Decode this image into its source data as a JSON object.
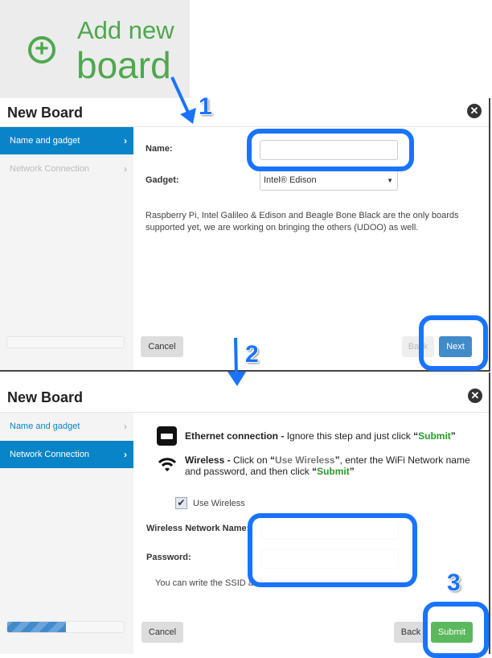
{
  "add_board": {
    "line1": "Add new",
    "line2": "board",
    "icon": "plus-circle-icon",
    "color": "#4ea84e"
  },
  "annotations": {
    "step1": "1",
    "step2": "2",
    "step3": "3",
    "color": "#1a73ff"
  },
  "panel1": {
    "title": "New Board",
    "sidebar": [
      {
        "label": "Name and gadget",
        "active": true
      },
      {
        "label": "Network Connection",
        "active": false
      }
    ],
    "name_label": "Name:",
    "name_value": "",
    "gadget_label": "Gadget:",
    "gadget_value": "Intel® Edison",
    "info": "Raspberry Pi, Intel Galileo & Edison and Beagle Bone Black are the only boards supported yet, we are working on bringing the others (UDOO) as well.",
    "progress_percent": 0,
    "cancel": "Cancel",
    "back": "Back",
    "next": "Next"
  },
  "panel2": {
    "title": "New Board",
    "sidebar": [
      {
        "label": "Name and gadget",
        "active": false
      },
      {
        "label": "Network Connection",
        "active": true
      }
    ],
    "ethernet": {
      "title": "Ethernet connection",
      "dash": " - ",
      "text": "Ignore this step and just click ",
      "q1": "“",
      "submit": "Submit",
      "q2": "”"
    },
    "wireless": {
      "title": "Wireless",
      "dash": " - ",
      "t1": "Click on ",
      "q1": "“",
      "use": "Use Wireless",
      "q2": "”",
      "t2": ", enter the WiFi Network name and password, and then click ",
      "q3": "“",
      "submit": "Submit",
      "q4": "”"
    },
    "use_wireless": "Use Wireless",
    "use_wireless_checked": true,
    "ssid_label": "Wireless Network Name:",
    "ssid_value": "",
    "password_label": "Password:",
    "password_value": "",
    "note": "You can write the SSID and",
    "progress_percent": 50,
    "cancel": "Cancel",
    "back": "Back",
    "submit": "Submit"
  }
}
